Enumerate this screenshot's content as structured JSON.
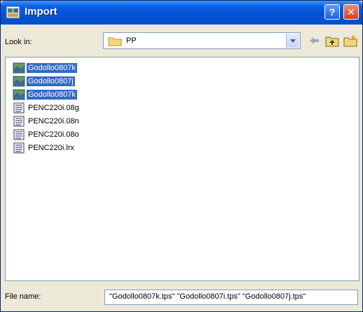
{
  "window": {
    "title": "Import",
    "help_glyph": "?",
    "close_glyph": "✕"
  },
  "lookin": {
    "label": "Look in:",
    "value": "PP"
  },
  "files": [
    {
      "name": "Godollo0807k",
      "selected": true,
      "icon": "map-file-icon"
    },
    {
      "name": "Godollo0807j",
      "selected": true,
      "icon": "map-file-icon"
    },
    {
      "name": "Godollo0807k",
      "selected": true,
      "icon": "map-file-icon"
    },
    {
      "name": "PENC220i.08g",
      "selected": false,
      "icon": "text-file-icon"
    },
    {
      "name": "PENC220i.08n",
      "selected": false,
      "icon": "text-file-icon"
    },
    {
      "name": "PENC220i.08o",
      "selected": false,
      "icon": "text-file-icon"
    },
    {
      "name": "PENC220i.lrx",
      "selected": false,
      "icon": "text-file-icon"
    }
  ],
  "filename": {
    "label": "File name:",
    "value": "\"Godollo0807k.tps\" \"Godollo0807i.tps\" \"Godollo0807j.tps\""
  },
  "colors": {
    "titlebar": "#0a5ee0",
    "selection": "#316ac5",
    "dialog_bg": "#ece9d8"
  }
}
